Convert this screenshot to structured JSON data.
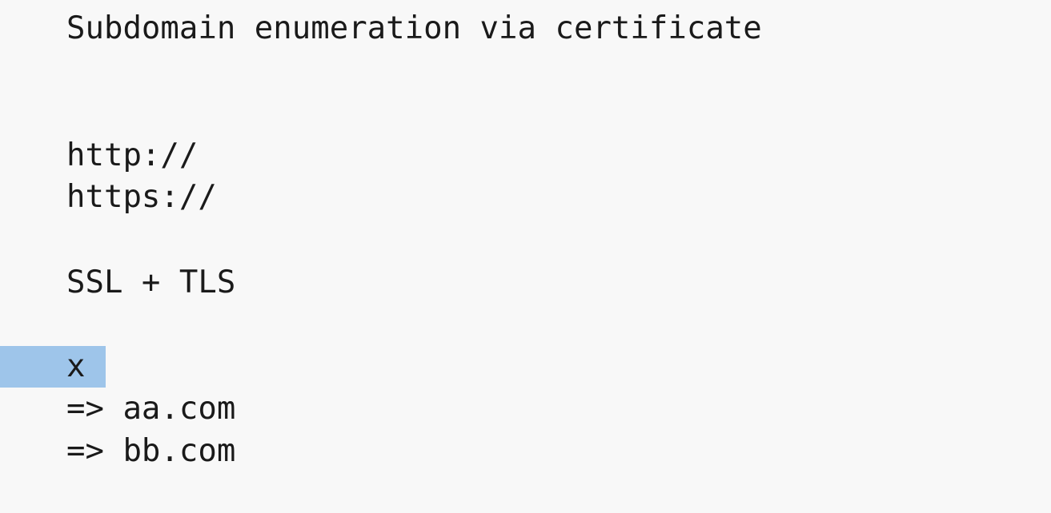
{
  "document": {
    "lines": [
      "Subdomain enumeration via certificate",
      "http://",
      "https://",
      "SSL + TLS",
      "x",
      "=> aa.com",
      "=> bb.com"
    ]
  }
}
